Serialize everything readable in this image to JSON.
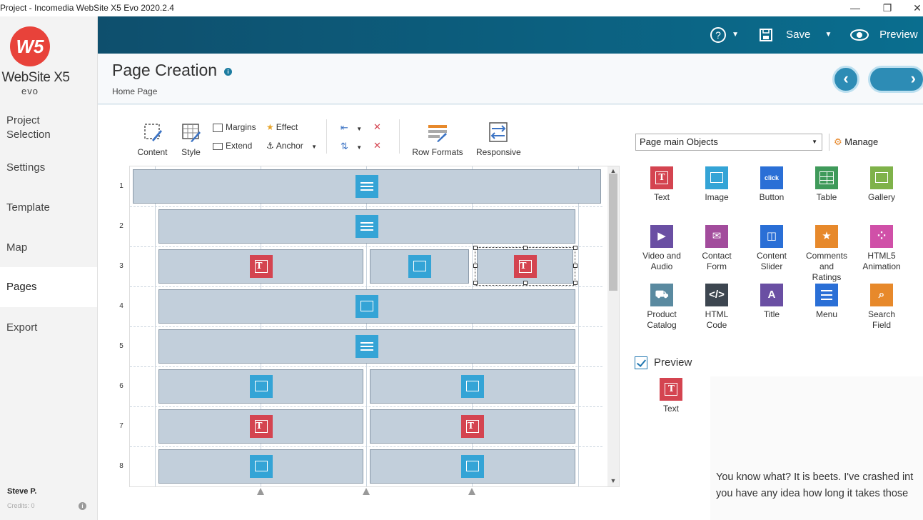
{
  "window": {
    "title": "Project - Incomedia WebSite X5 Evo 2020.2.4",
    "controls": [
      "—",
      "❐",
      "✕"
    ]
  },
  "brand": {
    "logo_mark": "W5",
    "name": "WebSite X5",
    "edition": "evo"
  },
  "sidebar": {
    "items": [
      {
        "label": "Project\nSelection"
      },
      {
        "label": "Settings"
      },
      {
        "label": "Template"
      },
      {
        "label": "Map"
      },
      {
        "label": "Pages",
        "active": true
      },
      {
        "label": "Export"
      }
    ],
    "user": "Steve P.",
    "credits": "Credits: 0"
  },
  "topbar": {
    "help": "?",
    "save": "Save",
    "preview": "Preview"
  },
  "header": {
    "title": "Page Creation",
    "breadcrumb": "Home Page"
  },
  "toolbar": {
    "content": "Content",
    "style": "Style",
    "margins": "Margins",
    "extend": "Extend",
    "effect": "Effect",
    "anchor": "Anchor",
    "row_formats": "Row Formats",
    "responsive": "Responsive"
  },
  "grid": {
    "rows": [
      {
        "num": "1",
        "cells": [
          "para"
        ]
      },
      {
        "num": "2",
        "cells": [
          "para"
        ]
      },
      {
        "num": "3",
        "cells": [
          "text",
          "image",
          "text"
        ]
      },
      {
        "num": "4",
        "cells": [
          "image"
        ]
      },
      {
        "num": "5",
        "cells": [
          "para"
        ]
      },
      {
        "num": "6",
        "cells": [
          "image",
          "image"
        ]
      },
      {
        "num": "7",
        "cells": [
          "text",
          "text"
        ]
      },
      {
        "num": "8",
        "cells": [
          "image",
          "image"
        ]
      }
    ]
  },
  "objects_panel": {
    "dropdown": "Page main Objects",
    "manage": "Manage",
    "items": [
      {
        "label": "Text",
        "icon": "text-icon",
        "color": "#d44450"
      },
      {
        "label": "Image",
        "icon": "image-icon",
        "color": "#34a4d6"
      },
      {
        "label": "Button",
        "icon": "button-icon",
        "color": "#2a6fd6",
        "glyph": "click"
      },
      {
        "label": "Table",
        "icon": "table-icon",
        "color": "#3f9a5a"
      },
      {
        "label": "Gallery",
        "icon": "gallery-icon",
        "color": "#7fb24a"
      },
      {
        "label": "Video and\nAudio",
        "icon": "video-icon",
        "color": "#6a4fa3"
      },
      {
        "label": "Contact\nForm",
        "icon": "mail-icon",
        "color": "#a24c9c"
      },
      {
        "label": "Content\nSlider",
        "icon": "slider-icon",
        "color": "#2a6fd6"
      },
      {
        "label": "Comments\nand\nRatings",
        "icon": "star-icon",
        "color": "#e7892b"
      },
      {
        "label": "HTML5\nAnimation",
        "icon": "animation-icon",
        "color": "#d050a8"
      },
      {
        "label": "Product\nCatalog",
        "icon": "cart-icon",
        "color": "#5a8aa0"
      },
      {
        "label": "HTML\nCode",
        "icon": "code-icon",
        "color": "#3d4650",
        "glyph": "</>"
      },
      {
        "label": "Title",
        "icon": "title-icon",
        "color": "#6a4fa3",
        "glyph": "A"
      },
      {
        "label": "Menu",
        "icon": "menu-icon",
        "color": "#2a6fd6"
      },
      {
        "label": "Search\nField",
        "icon": "search-icon",
        "color": "#e7892b"
      }
    ]
  },
  "preview": {
    "label": "Preview",
    "object_label": "Text",
    "text_line1": "You know what? It is beets. I've crashed int",
    "text_line2": "you have any idea how long it takes those"
  }
}
